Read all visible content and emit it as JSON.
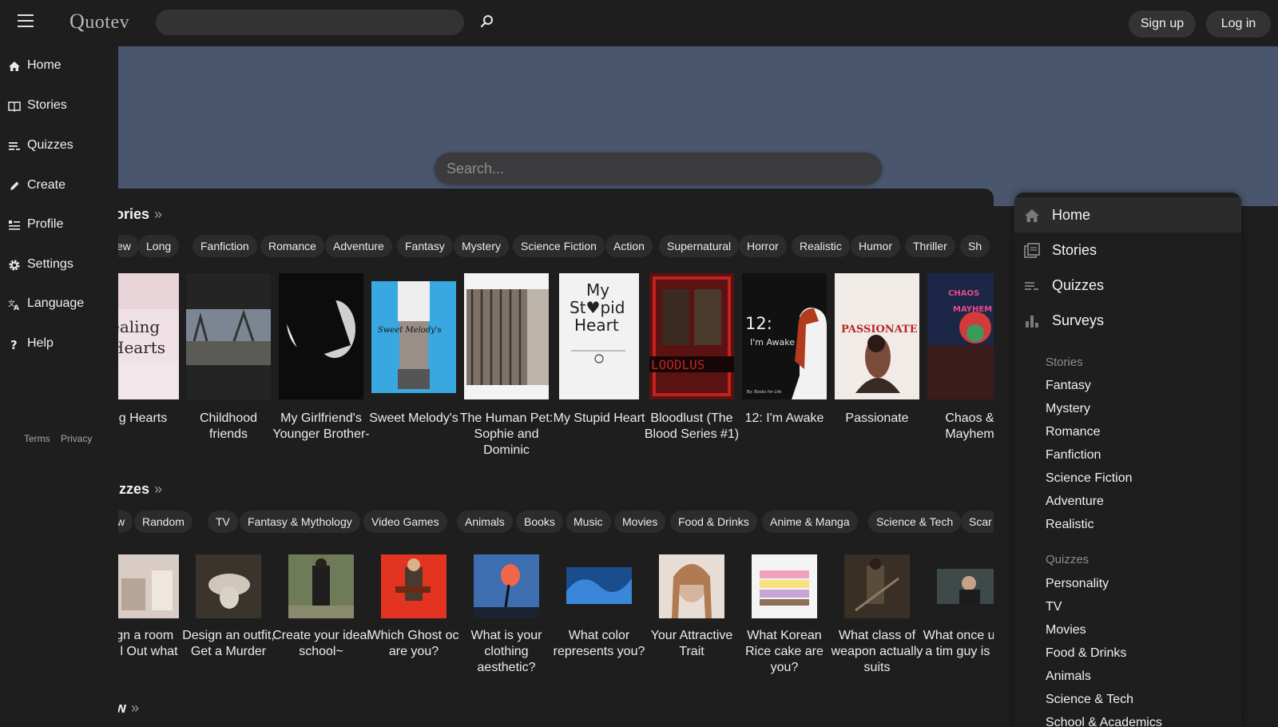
{
  "topbar": {
    "logo_first": "Q",
    "logo_rest": "uotev",
    "search_placeholder": "",
    "signup_label": "Sign up",
    "login_label": "Log in"
  },
  "leftnav": {
    "items": [
      {
        "label": "Home",
        "icon": "home-icon"
      },
      {
        "label": "Stories",
        "icon": "book-icon"
      },
      {
        "label": "Quizzes",
        "icon": "list-icon"
      },
      {
        "label": "Create",
        "icon": "pencil-icon"
      },
      {
        "label": "Profile",
        "icon": "profile-icon"
      },
      {
        "label": "Settings",
        "icon": "gear-icon"
      },
      {
        "label": "Language",
        "icon": "translate-icon"
      },
      {
        "label": "Help",
        "icon": "help-icon"
      }
    ],
    "terms": "Terms",
    "privacy": "Privacy"
  },
  "hero": {
    "search_placeholder": "Search..."
  },
  "stories": {
    "title": "ories",
    "more": "»",
    "tags": [
      "ew",
      "Long",
      "Fanfiction",
      "Romance",
      "Adventure",
      "Fantasy",
      "Mystery",
      "Science Fiction",
      "Action",
      "Supernatural",
      "Horror",
      "Realistic",
      "Humor",
      "Thriller",
      "Sh"
    ],
    "cards": [
      {
        "title": "ling Hearts",
        "cover_text": "ealing Hearts"
      },
      {
        "title": "Childhood friends"
      },
      {
        "title": "My Girlfriend's Younger Brother-"
      },
      {
        "title": "Sweet Melody's",
        "cover_text": "Sweet Melody's"
      },
      {
        "title": "The Human Pet: Sophie and Dominic"
      },
      {
        "title": "My Stupid Heart",
        "cover_text": "My Stupid Heart"
      },
      {
        "title": "Bloodlust (The Blood Series #1)",
        "cover_text": "LOODLUS"
      },
      {
        "title": "12: I'm Awake",
        "cover_text": "12:",
        "cover_sub": "I'm Awake",
        "cover_credit": "By: Books for Life"
      },
      {
        "title": "Passionate",
        "cover_text": "PASSIONATE"
      },
      {
        "title": "Chaos & Mayhem",
        "cover_text": "CHAOS & MAYHEM"
      }
    ]
  },
  "quizzes": {
    "title": "izzes",
    "more": "»",
    "tags": [
      "w",
      "Random",
      "TV",
      "Fantasy & Mythology",
      "Video Games",
      "Animals",
      "Books",
      "Music",
      "Movies",
      "Food & Drinks",
      "Anime & Manga",
      "Science & Tech",
      "Scar"
    ],
    "cards": [
      {
        "title": "esign a room and l Out what"
      },
      {
        "title": "Design an outfit, Get a Murder"
      },
      {
        "title": "Create your ideal school~"
      },
      {
        "title": "Which Ghost oc are you?"
      },
      {
        "title": "What is your clothing aesthetic?"
      },
      {
        "title": "What color represents you?"
      },
      {
        "title": "Your Attractive Trait"
      },
      {
        "title": "What Korean Rice cake are you?"
      },
      {
        "title": "What class of weapon actually suits"
      },
      {
        "title": "What once upon a tim guy is you"
      }
    ]
  },
  "bottom": {
    "title": "w",
    "more": "»"
  },
  "rightnav": {
    "items": [
      {
        "label": "Home",
        "icon": "home-icon",
        "active": true
      },
      {
        "label": "Stories",
        "icon": "stories-icon"
      },
      {
        "label": "Quizzes",
        "icon": "list-icon"
      },
      {
        "label": "Surveys",
        "icon": "bar-chart-icon"
      }
    ],
    "stories_heading": "Stories",
    "stories_links": [
      "Fantasy",
      "Mystery",
      "Romance",
      "Fanfiction",
      "Science Fiction",
      "Adventure",
      "Realistic"
    ],
    "quizzes_heading": "Quizzes",
    "quizzes_links": [
      "Personality",
      "TV",
      "Movies",
      "Food & Drinks",
      "Animals",
      "Science & Tech",
      "School & Academics"
    ]
  }
}
